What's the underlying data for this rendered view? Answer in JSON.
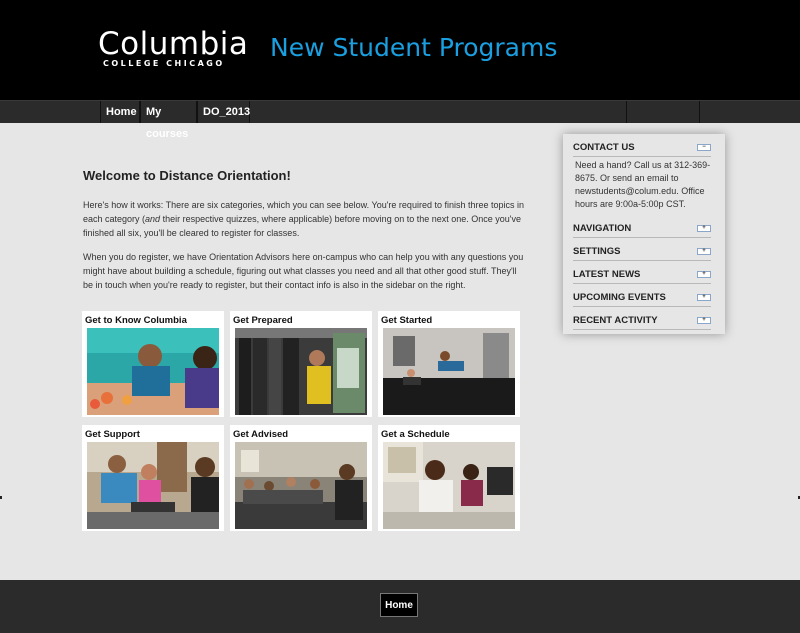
{
  "header": {
    "logo_main": "Columbia",
    "logo_sub": "COLLEGE CHICAGO",
    "site_title": "New Student Programs"
  },
  "nav": {
    "items": [
      {
        "label": "Home"
      },
      {
        "label": "My courses"
      },
      {
        "label": "DO_2013"
      }
    ]
  },
  "main": {
    "heading": "Welcome to Distance Orientation!",
    "para1_before": "Here's how it works: There are six categories, which you can see below. You're required to finish three topics in each category (",
    "para1_em": "and",
    "para1_after": " their respective quizzes, where applicable) before moving on to the next one. Once you've finished all six, you'll be cleared to register for classes.",
    "para2": "When you do register, we have Orientation Advisors here on-campus who can help you with any questions you might have about building a schedule, figuring out what classes you need and all that other good stuff. They'll be in touch when you're ready to register, but their contact info is also in the sidebar on the right."
  },
  "tiles": [
    {
      "title": "Get to Know Columbia",
      "icon": "photo-students-laughing"
    },
    {
      "title": "Get Prepared",
      "icon": "photo-closet-clothes"
    },
    {
      "title": "Get Started",
      "icon": "photo-dance-studio"
    },
    {
      "title": "Get Support",
      "icon": "photo-students-laptop"
    },
    {
      "title": "Get Advised",
      "icon": "photo-group-meeting"
    },
    {
      "title": "Get a Schedule",
      "icon": "photo-computer-lab"
    }
  ],
  "sidebar": {
    "contact_title": "CONTACT US",
    "contact_text": "Need a hand? Call us at 312-369-8675. Or send an email to newstudents@colum.edu. Office hours are 9:00a-5:00p CST.",
    "blocks": [
      {
        "title": "NAVIGATION"
      },
      {
        "title": "SETTINGS"
      },
      {
        "title": "LATEST NEWS"
      },
      {
        "title": "UPCOMING EVENTS"
      },
      {
        "title": "RECENT ACTIVITY"
      }
    ]
  },
  "footer": {
    "home_label": "Home"
  },
  "colors": {
    "accent": "#1a9fe0",
    "header_bg": "#000000",
    "nav_bg": "#2b2b2b",
    "page_bg": "#e6e6e6"
  }
}
